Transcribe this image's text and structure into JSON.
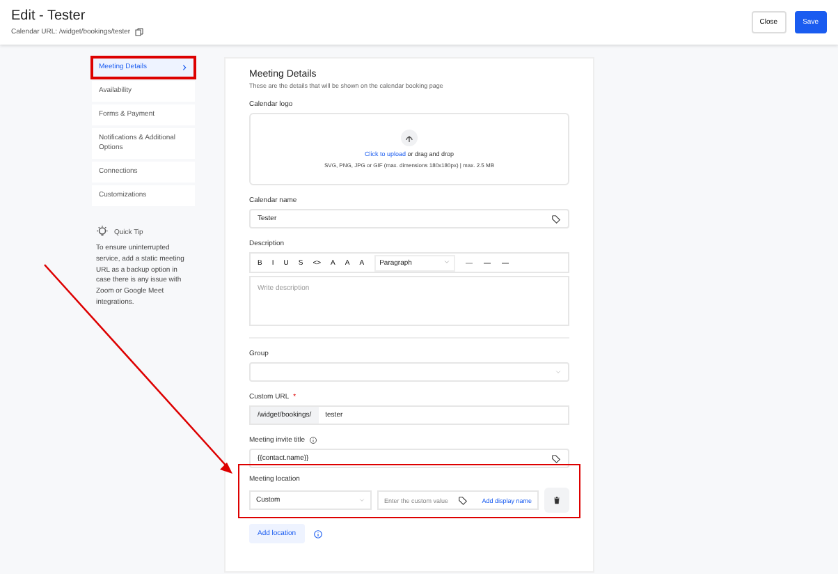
{
  "header": {
    "title": "Edit - Tester",
    "subtitle": "Calendar URL: /widget/bookings/tester",
    "buttons": [
      {
        "label": "Close",
        "kind": "secondary"
      },
      {
        "label": "Save",
        "kind": "primary"
      }
    ]
  },
  "sidebar": {
    "items": [
      {
        "label": "Meeting Details",
        "selected": true,
        "highlighted": true
      },
      {
        "label": "Availability",
        "selected": false,
        "highlighted": false
      },
      {
        "label": "Forms & Payment",
        "selected": false,
        "highlighted": false
      },
      {
        "label": "Notifications & Additional Options",
        "selected": false,
        "highlighted": false
      },
      {
        "label": "Connections",
        "selected": false,
        "highlighted": false
      },
      {
        "label": "Customizations",
        "selected": false,
        "highlighted": false
      }
    ],
    "tip": {
      "title": "Quick Tip",
      "text": "To ensure uninterrupted service, add a static meeting URL as a backup option in case there is any issue with Zoom or Google Meet integrations."
    }
  },
  "form": {
    "title": "Meeting Details",
    "subtitle": "These are the details that will be shown on the calendar booking page",
    "logo": {
      "label": "Calendar logo",
      "link": "Click to upload",
      "text": "or drag and drop",
      "hint": "SVG, PNG, JPG or GIF (max. dimensions 180x180px) | max. 2.5 MB"
    },
    "name": {
      "label": "Calendar name",
      "value": "Tester"
    },
    "description": {
      "label": "Description",
      "toolbar": [
        "B",
        "I",
        "U",
        "S",
        "<>",
        "A",
        "A",
        "A"
      ],
      "style": "Paragraph",
      "placeholder": "Write description"
    },
    "group": {
      "label": "Group"
    },
    "custom_url": {
      "label": "Custom URL",
      "required": true,
      "required_mark": "*",
      "prefix": "/widget/bookings/",
      "value": "tester"
    },
    "invite_title": {
      "label": "Meeting invite title",
      "value": "{{contact.name}}"
    },
    "location": {
      "label": "Meeting location",
      "highlighted": true,
      "type": "Custom",
      "placeholder": "Enter the custom value",
      "link": "Add display name"
    },
    "add_button": "Add location"
  }
}
